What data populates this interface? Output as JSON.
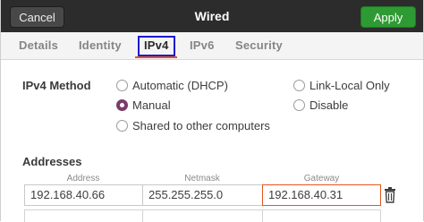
{
  "header": {
    "title": "Wired",
    "cancel_label": "Cancel",
    "apply_label": "Apply"
  },
  "tabs": [
    {
      "label": "Details"
    },
    {
      "label": "Identity"
    },
    {
      "label": "IPv4"
    },
    {
      "label": "IPv6"
    },
    {
      "label": "Security"
    }
  ],
  "active_tab": "IPv4",
  "ipv4_method": {
    "label": "IPv4 Method",
    "options": [
      {
        "label": "Automatic (DHCP)",
        "checked": false
      },
      {
        "label": "Link-Local Only",
        "checked": false
      },
      {
        "label": "Manual",
        "checked": true
      },
      {
        "label": "Disable",
        "checked": false
      },
      {
        "label": "Shared to other computers",
        "checked": false
      }
    ]
  },
  "addresses": {
    "label": "Addresses",
    "columns": [
      "Address",
      "Netmask",
      "Gateway"
    ],
    "rows": [
      {
        "address": "192.168.40.66",
        "netmask": "255.255.255.0",
        "gateway": "192.168.40.31"
      }
    ]
  },
  "colors": {
    "header_bg": "#2c2c2c",
    "apply_green": "#2e9a33",
    "accent_orange": "#e95420",
    "radio_checked": "#7a3b6b",
    "highlight_box": "#1b1bd0"
  },
  "icons": {
    "remove_row": "trash-icon"
  }
}
